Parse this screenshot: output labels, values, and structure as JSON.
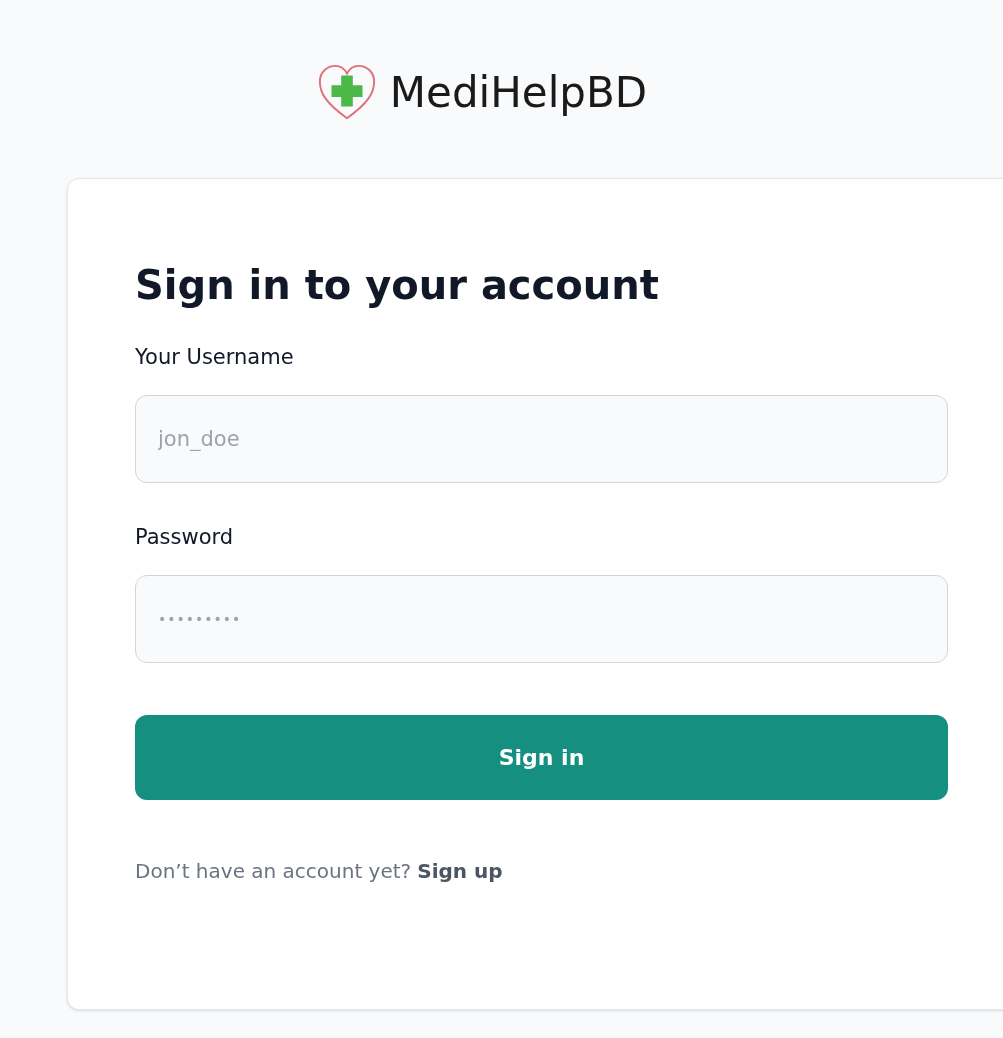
{
  "brand": {
    "name": "MediHelpBD"
  },
  "form": {
    "title": "Sign in to your account",
    "fields": [
      {
        "label": "Your Username",
        "placeholder": "jon_doe",
        "kind": "text"
      },
      {
        "label": "Password",
        "placeholder": "•••••••••",
        "kind": "password"
      }
    ],
    "submit": "Sign in",
    "footer": {
      "text": "Don’t have an account yet?",
      "link": "Sign up"
    }
  }
}
